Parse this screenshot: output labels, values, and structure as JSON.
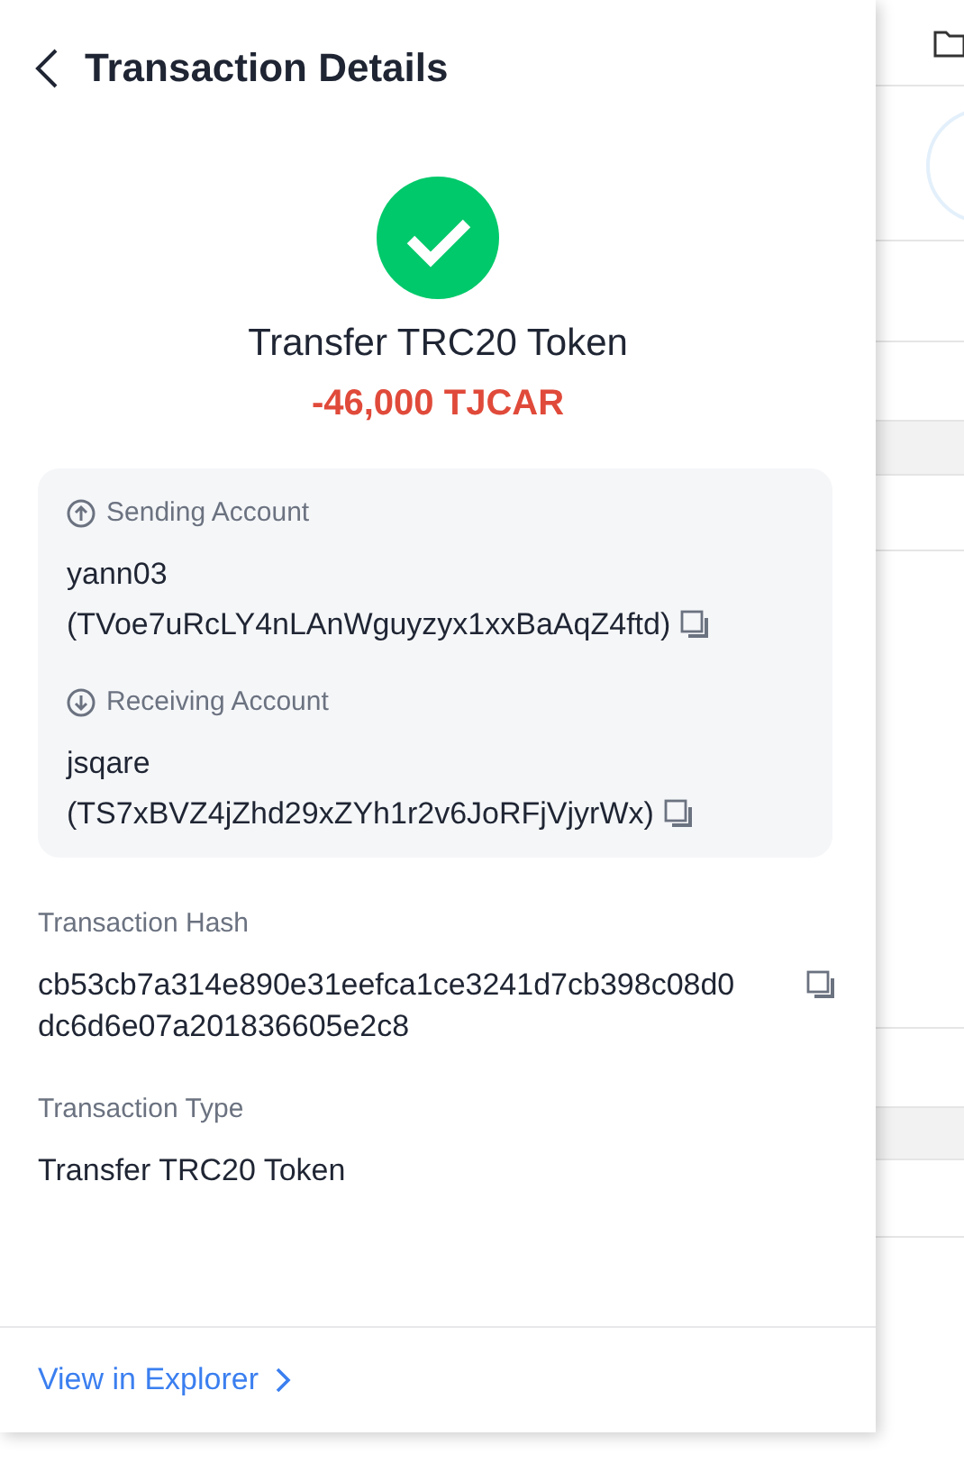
{
  "header": {
    "title": "Transaction Details"
  },
  "status": {
    "kind": "success",
    "title": "Transfer TRC20 Token",
    "amount": "-46,000 TJCAR"
  },
  "accounts": [
    {
      "kind": "sending",
      "label": "Sending Account",
      "name": "yann03",
      "address": "(TVoe7uRcLY4nLAnWguyzyx1xxBaAqZ4ftd)"
    },
    {
      "kind": "receiving",
      "label": "Receiving Account",
      "name": "jsqare",
      "address": "(TS7xBVZ4jZhd29xZYh1r2v6JoRFjVjyrWx)"
    }
  ],
  "fields": [
    {
      "kind": "copyable",
      "label": "Transaction Hash",
      "value": "cb53cb7a314e890e31eefca1ce3241d7cb398c08d0dc6d6e07a201836605e2c8"
    },
    {
      "kind": "plain",
      "label": "Transaction Type",
      "value": "Transfer TRC20 Token"
    }
  ],
  "footer": {
    "link": "View in Explorer"
  }
}
